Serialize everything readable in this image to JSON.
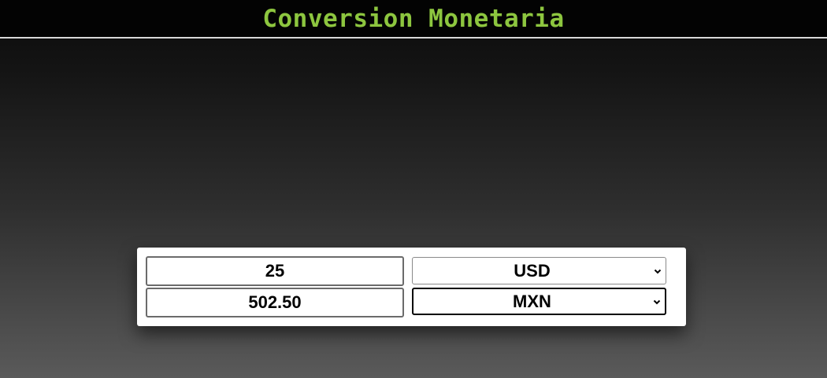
{
  "header": {
    "title": "Conversion Monetaria"
  },
  "converter": {
    "from_amount": "25",
    "to_amount": "502.50",
    "from_currency": "USD",
    "to_currency": "MXN"
  },
  "colors": {
    "title_accent": "#8dc63f",
    "header_bg": "#030303",
    "card_bg": "#ffffff"
  },
  "icons": {
    "select_arrow": "chevron-down-icon"
  }
}
